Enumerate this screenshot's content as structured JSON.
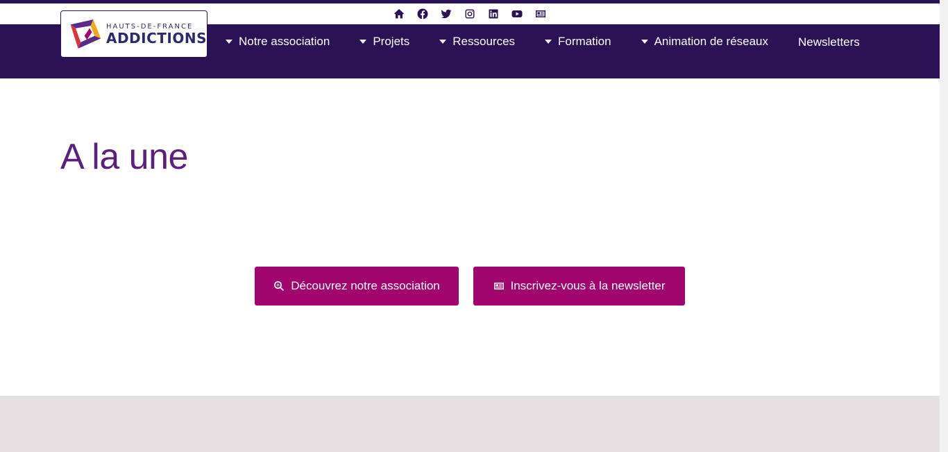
{
  "colors": {
    "brand": "#2b1255",
    "accent": "#a3056e",
    "headline": "#5b1f7e",
    "footer": "#e5e0e2"
  },
  "social": [
    {
      "name": "home-icon"
    },
    {
      "name": "facebook-icon"
    },
    {
      "name": "twitter-icon"
    },
    {
      "name": "instagram-icon"
    },
    {
      "name": "linkedin-icon"
    },
    {
      "name": "youtube-icon"
    },
    {
      "name": "newspaper-icon"
    }
  ],
  "logo": {
    "small": "HAUTS-DE-FRANCE",
    "big": "ADDICTIONS"
  },
  "menu": {
    "items": [
      {
        "label": "Notre association",
        "dropdown": true
      },
      {
        "label": "Projets",
        "dropdown": true
      },
      {
        "label": "Ressources",
        "dropdown": true
      },
      {
        "label": "Formation",
        "dropdown": true
      },
      {
        "label": "Animation de réseaux",
        "dropdown": true
      },
      {
        "label": "Newsletters",
        "dropdown": false
      }
    ]
  },
  "main": {
    "headline": "A la une",
    "buttons": {
      "association": "Découvrez notre association",
      "newsletter": "Inscrivez-vous à la newsletter"
    }
  }
}
